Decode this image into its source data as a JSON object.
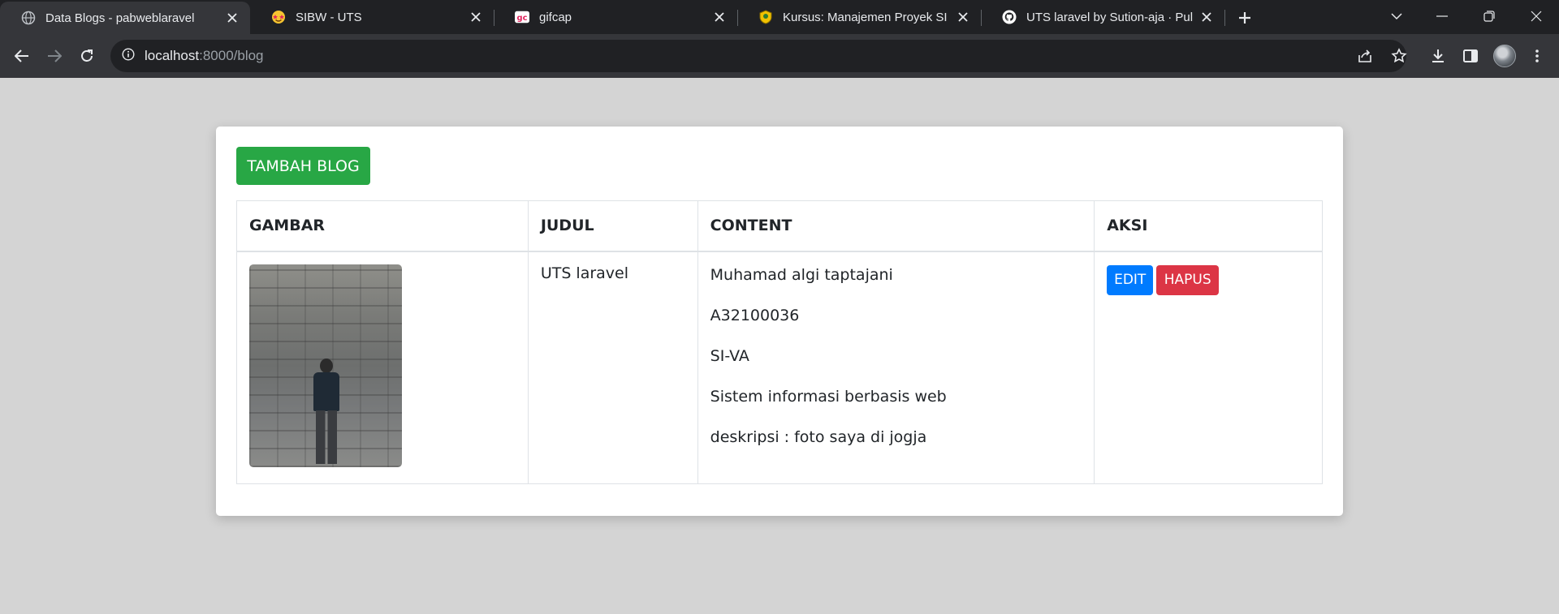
{
  "browser": {
    "tabs": [
      {
        "title": "Data Blogs - pabweblaravel",
        "icon": "globe-icon",
        "active": true
      },
      {
        "title": "SIBW - UTS",
        "icon": "star-struck-emoji-icon",
        "active": false
      },
      {
        "title": "gifcap",
        "icon": "gifcap-logo-icon",
        "active": false
      },
      {
        "title": "Kursus: Manajemen Proyek SI SI",
        "icon": "university-crest-icon",
        "active": false
      },
      {
        "title": "UTS laravel by Sution-aja · Pull R",
        "icon": "github-icon",
        "active": false
      }
    ],
    "address": {
      "host": "localhost",
      "path": ":8000/blog"
    }
  },
  "page": {
    "add_button": "TAMBAH BLOG",
    "table": {
      "headers": [
        "GAMBAR",
        "JUDUL",
        "CONTENT",
        "AKSI"
      ],
      "rows": [
        {
          "judul": "UTS laravel",
          "content": [
            "Muhamad algi taptajani",
            "A32100036",
            "SI-VA",
            "Sistem informasi berbasis web",
            "deskripsi : foto saya di jogja"
          ],
          "edit_label": "EDIT",
          "delete_label": "HAPUS"
        }
      ]
    }
  },
  "colors": {
    "page_bg": "#d4d4d4",
    "add": "#28a745",
    "edit": "#007bff",
    "delete": "#dc3545"
  }
}
